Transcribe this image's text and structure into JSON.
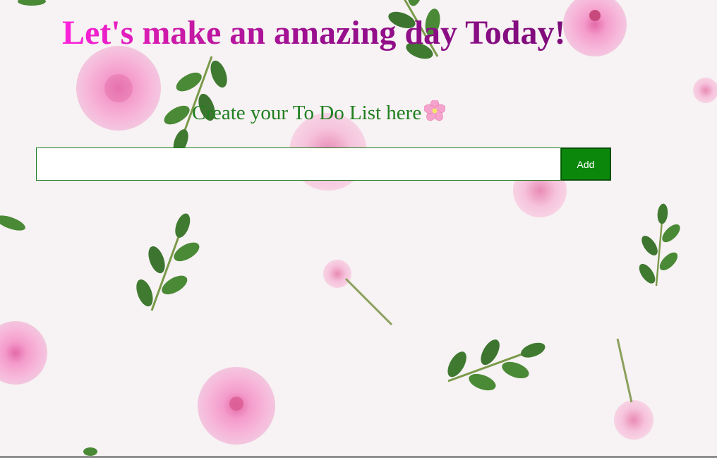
{
  "page": {
    "title": "Let's make an amazing day Today!",
    "subtitle": "Create your To Do List here"
  },
  "form": {
    "input_value": "",
    "input_placeholder": "",
    "add_label": "Add"
  },
  "colors": {
    "title_gradient_start": "#ff22dd",
    "title_gradient_end": "#7d0c7a",
    "subtitle": "#1f7f1f",
    "button_bg": "#0b870b",
    "button_text": "#ffffff",
    "input_border": "#1d7a1d"
  },
  "background": {
    "description_icon": "rose-and-leaf-pattern"
  }
}
